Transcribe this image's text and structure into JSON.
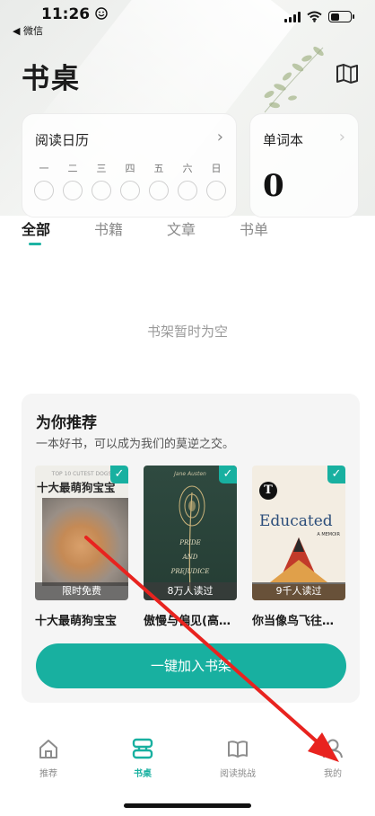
{
  "status_bar": {
    "time": "11:26",
    "time_icon": "smiley-face-icon",
    "back_app": "◀ 微信"
  },
  "header": {
    "title": "书桌",
    "map_icon": "map-icon"
  },
  "calendar_card": {
    "title": "阅读日历",
    "arrow": "›",
    "days": [
      "一",
      "二",
      "三",
      "四",
      "五",
      "六",
      "日"
    ]
  },
  "vocab_card": {
    "title": "单词本",
    "arrow": "›",
    "count": "0"
  },
  "tabs": [
    {
      "label": "全部",
      "active": true
    },
    {
      "label": "书籍",
      "active": false
    },
    {
      "label": "文章",
      "active": false
    },
    {
      "label": "书单",
      "active": false
    }
  ],
  "empty_text": "书架暂时为空",
  "recommend": {
    "title": "为你推荐",
    "subtitle": "一本好书，可以成为我们的莫逆之交。",
    "check_icon": "✓",
    "books": [
      {
        "cover_top": "TOP 10 CUTEST DOGS",
        "cover_title": "十大最萌狗宝宝",
        "badge": "限时免费",
        "name": "十大最萌狗宝宝"
      },
      {
        "cover_author": "Jane Austen",
        "cover_lines": [
          "PRIDE",
          "AND",
          "PREJUDICE"
        ],
        "badge": "8万人读过",
        "name": "傲慢与偏见(高…"
      },
      {
        "cover_logo": "T",
        "cover_title": "Educated",
        "cover_sub": "A MEMOIR",
        "badge": "9千人读过",
        "name": "你当像鸟飞往…"
      }
    ],
    "button": "一键加入书架"
  },
  "bottom_nav": [
    {
      "label": "推荐",
      "icon": "home-icon",
      "active": false
    },
    {
      "label": "书桌",
      "icon": "desk-icon",
      "active": true
    },
    {
      "label": "阅读挑战",
      "icon": "open-book-icon",
      "active": false
    },
    {
      "label": "我的",
      "icon": "profile-icon",
      "active": false
    }
  ],
  "colors": {
    "accent": "#18b0a0",
    "annotation_arrow": "#e8231f"
  }
}
